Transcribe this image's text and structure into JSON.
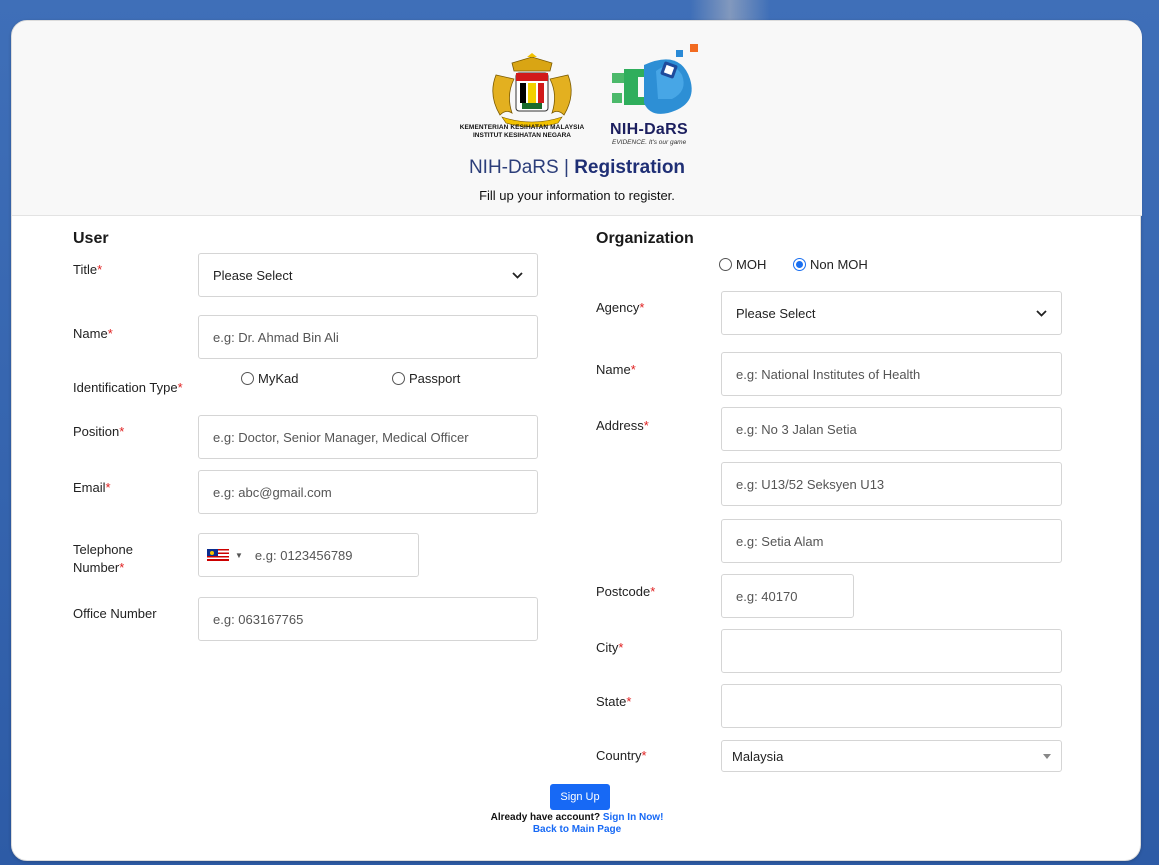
{
  "header": {
    "ministry_line1": "KEMENTERIAN KESIHATAN MALAYSIA",
    "ministry_line2": "INSTITUT KESIHATAN NEGARA",
    "brand_name": "NIH-DaRS",
    "brand_tagline": "EVIDENCE. It's our game",
    "heading_prefix": "NIH-DaRS",
    "heading_sep": " | ",
    "heading_strong": "Registration",
    "subtitle": "Fill up your information to register."
  },
  "user": {
    "section_title": "User",
    "title_label": "Title",
    "title_value": "Please Select",
    "name_label": "Name",
    "name_placeholder": "e.g: Dr. Ahmad Bin Ali",
    "id_type_label": "Identification Type",
    "id_options": [
      "MyKad",
      "Passport"
    ],
    "position_label": "Position",
    "position_placeholder": "e.g: Doctor, Senior Manager, Medical Officer",
    "email_label": "Email",
    "email_placeholder": "e.g: abc@gmail.com",
    "telephone_label_1": "Telephone",
    "telephone_label_2": "Number",
    "telephone_placeholder": "e.g: 0123456789",
    "office_label": "Office Number",
    "office_placeholder": "e.g: 063167765"
  },
  "organization": {
    "section_title": "Organization",
    "type_options": [
      "MOH",
      "Non MOH"
    ],
    "type_selected": "Non MOH",
    "agency_label": "Agency",
    "agency_value": "Please Select",
    "name_label": "Name",
    "name_placeholder": "e.g: National Institutes of Health",
    "address_label": "Address",
    "address1_placeholder": "e.g: No 3 Jalan Setia",
    "address2_placeholder": "e.g: U13/52 Seksyen U13",
    "address3_placeholder": "e.g: Setia Alam",
    "postcode_label": "Postcode",
    "postcode_placeholder": "e.g: 40170",
    "city_label": "City",
    "city_value": "",
    "state_label": "State",
    "state_value": "",
    "country_label": "Country",
    "country_value": "Malaysia"
  },
  "footer": {
    "signup_label": "Sign Up",
    "have_account_text": "Already have account?",
    "signin_link": "Sign In Now!",
    "back_link": "Back to Main Page"
  },
  "required_mark": "*",
  "colors": {
    "primary": "#1769f5",
    "heading": "#1f2f75",
    "required": "#e02020",
    "background": "#2d5ba6"
  }
}
